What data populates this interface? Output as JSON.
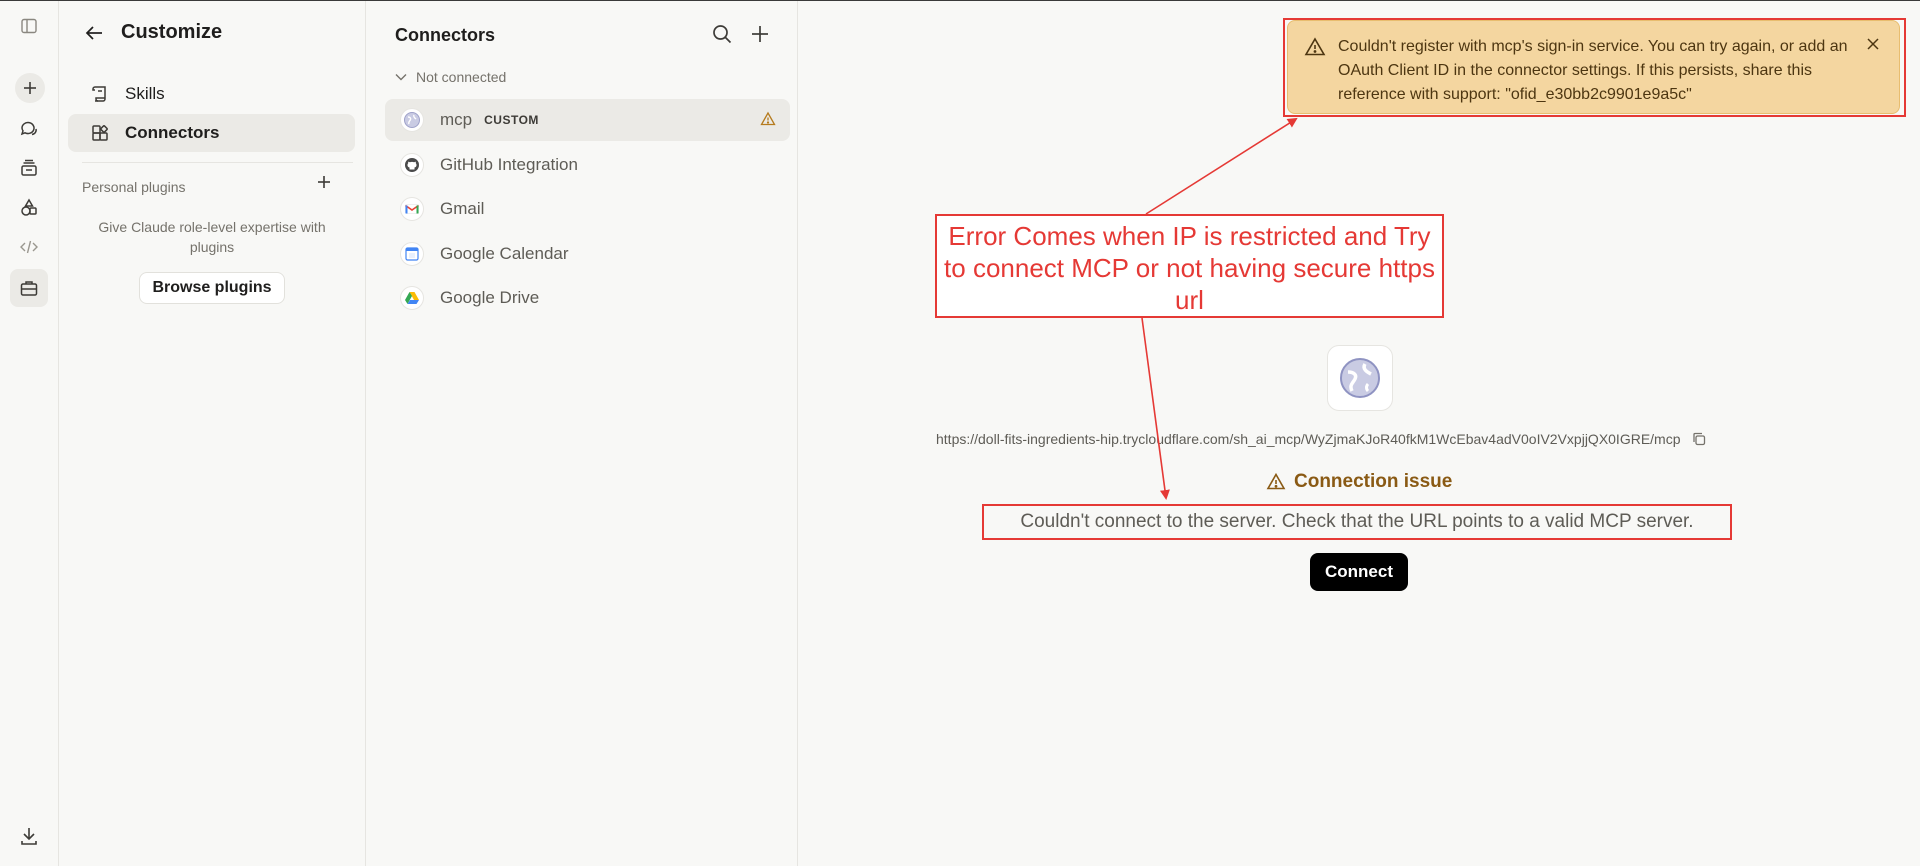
{
  "customize": {
    "title": "Customize",
    "nav": [
      {
        "label": "Skills",
        "icon": "scroll-icon"
      },
      {
        "label": "Connectors",
        "icon": "grid-icon"
      }
    ],
    "personal_plugins_label": "Personal plugins",
    "plugins_description": "Give Claude role-level expertise with plugins",
    "browse_plugins_label": "Browse plugins"
  },
  "connectors": {
    "title": "Connectors",
    "group_label": "Not connected",
    "items": [
      {
        "name": "mcp",
        "badge": "CUSTOM",
        "icon": "globe-icon",
        "warning": true
      },
      {
        "name": "GitHub Integration",
        "icon": "github-icon"
      },
      {
        "name": "Gmail",
        "icon": "gmail-icon"
      },
      {
        "name": "Google Calendar",
        "icon": "calendar-icon"
      },
      {
        "name": "Google Drive",
        "icon": "drive-icon"
      }
    ]
  },
  "toast": {
    "message": "Couldn't register with mcp's sign-in service. You can try again, or add an OAuth Client ID in the connector settings. If this persists, share this reference with support: \"ofid_e30bb2c9901e9a5c\""
  },
  "annotation": {
    "text": "Error Comes when IP is restricted and Try to connect MCP or not having secure https url"
  },
  "detail": {
    "url": "https://doll-fits-ingredients-hip.trycloudflare.com/sh_ai_mcp/WyZjmaKJoR40fkM1WcEbav4adV0oIV2VxpjjQX0IGRE/mcp",
    "issue_title": "Connection issue",
    "error_message": "Couldn't connect to the server. Check that the URL points to a valid MCP server.",
    "connect_label": "Connect"
  },
  "colors": {
    "annotation_red": "#e53935",
    "toast_bg": "#f4d6a0",
    "warning_brown": "#8a5a14"
  }
}
